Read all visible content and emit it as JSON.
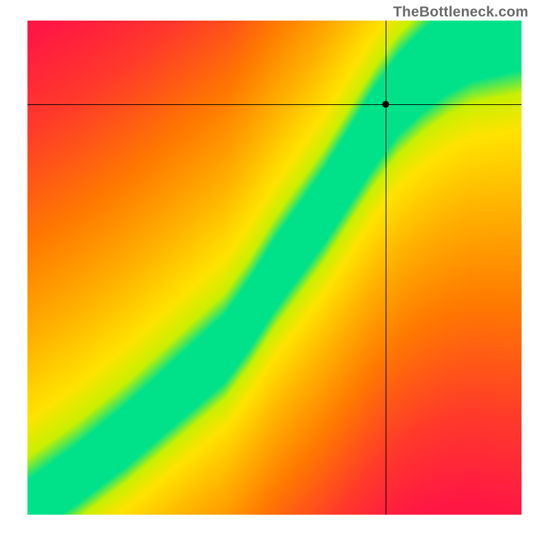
{
  "watermark": "TheBottleneck.com",
  "chart_data": {
    "type": "heatmap",
    "title": "",
    "xlabel": "",
    "ylabel": "",
    "xlim": [
      0,
      1
    ],
    "ylim": [
      0,
      1
    ],
    "grid": false,
    "legend": false,
    "crosshair": {
      "x": 0.725,
      "y": 0.83
    },
    "optimal_curve": {
      "description": "Green ridge of optimal pairing; color encodes distance from ridge (green=close, yellow=medium, red/orange=far)",
      "points": [
        {
          "x": 0.0,
          "y": 0.0
        },
        {
          "x": 0.1,
          "y": 0.07
        },
        {
          "x": 0.2,
          "y": 0.15
        },
        {
          "x": 0.3,
          "y": 0.24
        },
        {
          "x": 0.4,
          "y": 0.33
        },
        {
          "x": 0.45,
          "y": 0.4
        },
        {
          "x": 0.5,
          "y": 0.48
        },
        {
          "x": 0.55,
          "y": 0.55
        },
        {
          "x": 0.6,
          "y": 0.62
        },
        {
          "x": 0.65,
          "y": 0.7
        },
        {
          "x": 0.7,
          "y": 0.78
        },
        {
          "x": 0.75,
          "y": 0.85
        },
        {
          "x": 0.8,
          "y": 0.9
        },
        {
          "x": 0.85,
          "y": 0.94
        },
        {
          "x": 0.9,
          "y": 0.97
        },
        {
          "x": 1.0,
          "y": 1.0
        }
      ]
    },
    "color_stops": [
      {
        "d": 0.0,
        "color": "#00e28a"
      },
      {
        "d": 0.05,
        "color": "#00e28a"
      },
      {
        "d": 0.1,
        "color": "#c8f000"
      },
      {
        "d": 0.18,
        "color": "#ffe300"
      },
      {
        "d": 0.35,
        "color": "#ffb000"
      },
      {
        "d": 0.55,
        "color": "#ff7a00"
      },
      {
        "d": 0.8,
        "color": "#ff3a2a"
      },
      {
        "d": 1.0,
        "color": "#ff1744"
      }
    ]
  }
}
